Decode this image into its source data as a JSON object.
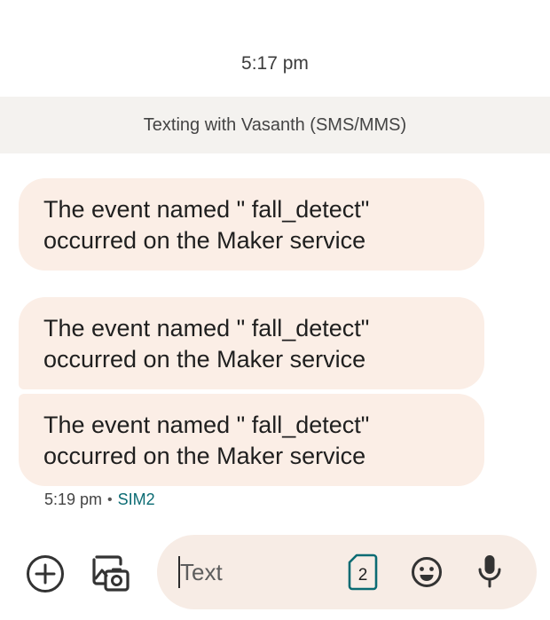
{
  "conversation": {
    "top_timestamp": "5:17 pm",
    "banner": "Texting with Vasanth (SMS/MMS)",
    "messages": [
      {
        "line1": "The event named \" fall_detect\"",
        "line2": "occurred on the Maker service"
      },
      {
        "line1": "The event named \" fall_detect\"",
        "line2": "occurred on the Maker service"
      },
      {
        "line1": "The event named \" fall_detect\"",
        "line2": "occurred on the Maker service"
      }
    ],
    "last_meta": {
      "time": "5:19 pm",
      "separator": "•",
      "sim": "SIM2"
    }
  },
  "compose": {
    "placeholder": "Text",
    "sim_number": "2",
    "icons": [
      "add-icon",
      "gallery-icon",
      "sim-card-icon",
      "emoji-icon",
      "mic-icon"
    ],
    "colors": {
      "accent": "#0b6b73",
      "bubble": "#fbeee6",
      "compose_bg": "#f7ece5"
    }
  }
}
